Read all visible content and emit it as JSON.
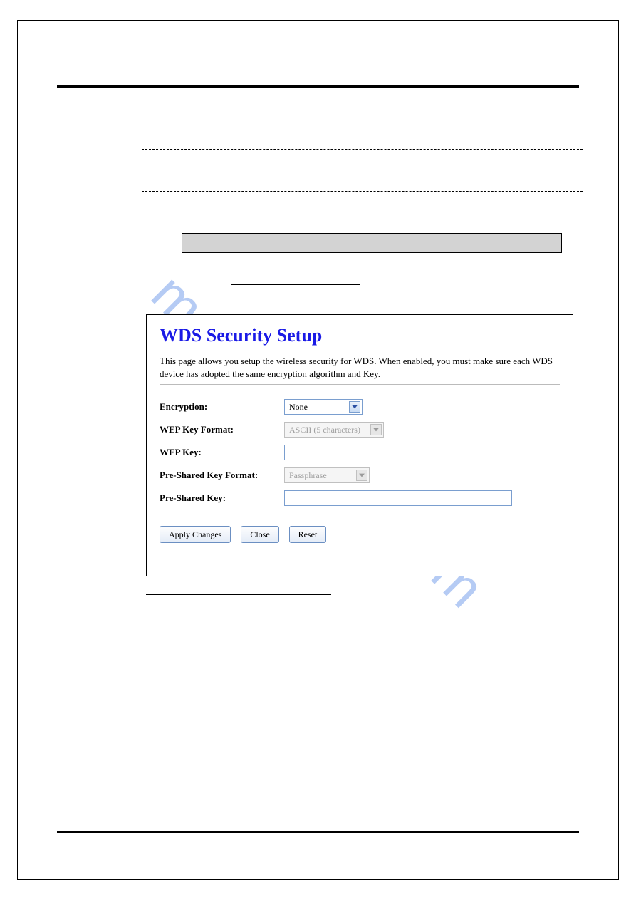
{
  "watermark": "manualshive.com",
  "panel": {
    "title": "WDS Security Setup",
    "description": "This page allows you setup the wireless security for WDS. When enabled, you must make sure each WDS device has adopted the same encryption algorithm and Key.",
    "fields": {
      "encryption": {
        "label": "Encryption:",
        "value": "None"
      },
      "wep_key_format": {
        "label": "WEP Key Format:",
        "value": "ASCII (5 characters)"
      },
      "wep_key": {
        "label": "WEP Key:",
        "value": ""
      },
      "psk_format": {
        "label": "Pre-Shared Key Format:",
        "value": "Passphrase"
      },
      "psk": {
        "label": "Pre-Shared Key:",
        "value": ""
      }
    },
    "buttons": {
      "apply": "Apply Changes",
      "close": "Close",
      "reset": "Reset"
    }
  }
}
